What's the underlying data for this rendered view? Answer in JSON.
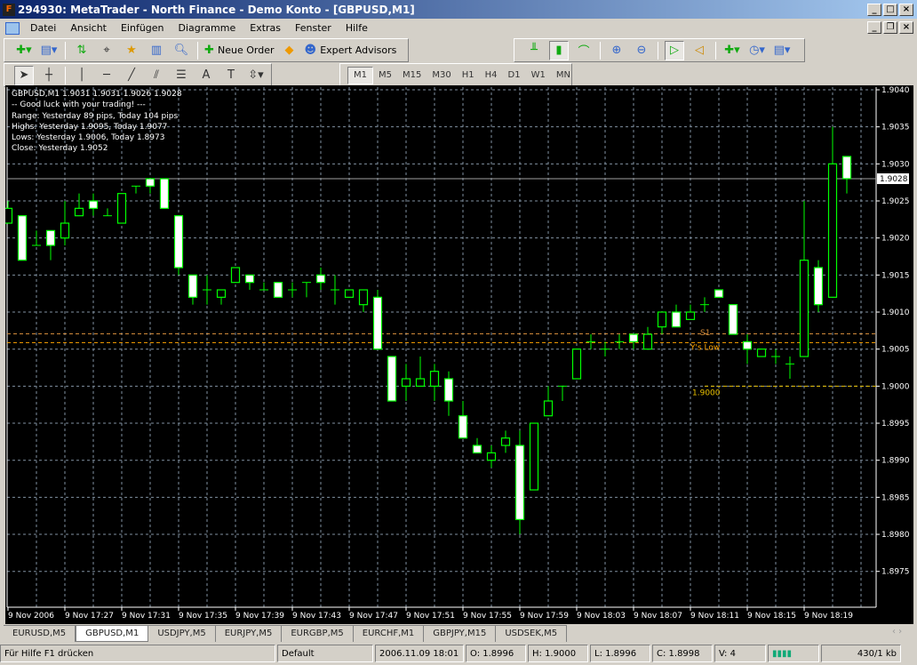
{
  "window": {
    "title": "294930: MetaTrader - North Finance - Demo Konto - [GBPUSD,M1]"
  },
  "menu": [
    "Datei",
    "Ansicht",
    "Einfügen",
    "Diagramme",
    "Extras",
    "Fenster",
    "Hilfe"
  ],
  "toolbar": {
    "new_order": "Neue Order",
    "expert_advisors": "Expert Advisors"
  },
  "timeframes": [
    "M1",
    "M5",
    "M15",
    "M30",
    "H1",
    "H4",
    "D1",
    "W1",
    "MN"
  ],
  "selected_timeframe": "M1",
  "info": {
    "line1": "GBPUSD,M1  1.9031 1.9031 1.9026 1.9028",
    "line2": "-- Good luck with your trading! ---",
    "line3": "Range: Yesterday 89 pips, Today 104 pips",
    "line4": "Highs: Yesterday 1.9095, Today 1.9077",
    "line5": "Lows:  Yesterday 1.9006, Today 1.8973",
    "line6": "Close: Yesterday 1.9052"
  },
  "chart_data": {
    "type": "candlestick",
    "symbol": "GBPUSD",
    "timeframe": "M1",
    "ylim": [
      1.897,
      1.904
    ],
    "yticks": [
      "1.9040",
      "1.9035",
      "1.9030",
      "1.9025",
      "1.9020",
      "1.9015",
      "1.9010",
      "1.9005",
      "1.9000",
      "1.8995",
      "1.8990",
      "1.8985",
      "1.8980",
      "1.8975"
    ],
    "xticks": [
      "9 Nov 2006",
      "9 Nov 17:27",
      "9 Nov 17:31",
      "9 Nov 17:35",
      "9 Nov 17:39",
      "9 Nov 17:43",
      "9 Nov 17:47",
      "9 Nov 17:51",
      "9 Nov 17:55",
      "9 Nov 17:59",
      "9 Nov 18:03",
      "9 Nov 18:07",
      "9 Nov 18:11",
      "9 Nov 18:15",
      "9 Nov 18:19"
    ],
    "current_price": "1.9028",
    "levels": [
      {
        "label": "S1",
        "price": 1.9007,
        "color": "#d08a3a"
      },
      {
        "label": "Y's Low",
        "price": 1.9006,
        "color": "#ffa500"
      },
      {
        "label": "1.9000",
        "price": 1.9,
        "color": "#e8c000"
      }
    ],
    "colors": {
      "bull": "#000000",
      "bear": "#ffffff",
      "outline": "#00ff00",
      "grid": "#8090a0"
    },
    "ohlc": [
      [
        1.9022,
        1.9025,
        1.9022,
        1.9024
      ],
      [
        1.9023,
        1.9023,
        1.9017,
        1.9017
      ],
      [
        1.9019,
        1.9021,
        1.9019,
        1.9019
      ],
      [
        1.9021,
        1.9021,
        1.9017,
        1.9019
      ],
      [
        1.902,
        1.9025,
        1.9019,
        1.9022
      ],
      [
        1.9023,
        1.9026,
        1.9023,
        1.9024
      ],
      [
        1.9025,
        1.9026,
        1.9023,
        1.9024
      ],
      [
        1.9023,
        1.9024,
        1.9023,
        1.9023
      ],
      [
        1.9022,
        1.9026,
        1.9022,
        1.9026
      ],
      [
        1.9027,
        1.9027,
        1.9026,
        1.9027
      ],
      [
        1.9028,
        1.9028,
        1.9026,
        1.9027
      ],
      [
        1.9028,
        1.9028,
        1.9024,
        1.9024
      ],
      [
        1.9023,
        1.9023,
        1.9015,
        1.9016
      ],
      [
        1.9015,
        1.9015,
        1.9011,
        1.9012
      ],
      [
        1.9013,
        1.9015,
        1.9011,
        1.9013
      ],
      [
        1.9012,
        1.9013,
        1.9011,
        1.9013
      ],
      [
        1.9014,
        1.9016,
        1.9014,
        1.9016
      ],
      [
        1.9015,
        1.9015,
        1.9013,
        1.9014
      ],
      [
        1.9013,
        1.9014,
        1.9013,
        1.9013
      ],
      [
        1.9014,
        1.9014,
        1.9012,
        1.9012
      ],
      [
        1.9013,
        1.9014,
        1.9012,
        1.9013
      ],
      [
        1.9014,
        1.9014,
        1.9012,
        1.9014
      ],
      [
        1.9015,
        1.9016,
        1.9013,
        1.9014
      ],
      [
        1.9013,
        1.9015,
        1.9011,
        1.9013
      ],
      [
        1.9012,
        1.9013,
        1.9012,
        1.9013
      ],
      [
        1.9011,
        1.9013,
        1.901,
        1.9013
      ],
      [
        1.9012,
        1.9013,
        1.9005,
        1.9005
      ],
      [
        1.9004,
        1.9004,
        1.8998,
        1.8998
      ],
      [
        1.9,
        1.9003,
        1.8998,
        1.9001
      ],
      [
        1.9,
        1.9004,
        1.9,
        1.9001
      ],
      [
        1.9,
        1.9003,
        1.8998,
        1.9002
      ],
      [
        1.9001,
        1.9002,
        1.8996,
        1.8998
      ],
      [
        1.8996,
        1.8998,
        1.8993,
        1.8993
      ],
      [
        1.8992,
        1.8993,
        1.8991,
        1.8991
      ],
      [
        1.899,
        1.8992,
        1.8989,
        1.8991
      ],
      [
        1.8992,
        1.8994,
        1.8991,
        1.8993
      ],
      [
        1.8992,
        1.8994,
        1.898,
        1.8982
      ],
      [
        1.8986,
        1.8995,
        1.8986,
        1.8995
      ],
      [
        1.8996,
        1.9,
        1.8996,
        1.8998
      ],
      [
        1.9,
        1.9,
        1.8998,
        1.9
      ],
      [
        1.9001,
        1.9005,
        1.9001,
        1.9005
      ],
      [
        1.9006,
        1.9007,
        1.9005,
        1.9006
      ],
      [
        1.9005,
        1.9006,
        1.9004,
        1.9005
      ],
      [
        1.9006,
        1.9007,
        1.9005,
        1.9006
      ],
      [
        1.9007,
        1.9007,
        1.9005,
        1.9006
      ],
      [
        1.9005,
        1.9008,
        1.9005,
        1.9007
      ],
      [
        1.9008,
        1.901,
        1.9007,
        1.901
      ],
      [
        1.901,
        1.9011,
        1.9008,
        1.9008
      ],
      [
        1.9009,
        1.9011,
        1.9009,
        1.901
      ],
      [
        1.9011,
        1.9012,
        1.901,
        1.9011
      ],
      [
        1.9013,
        1.9013,
        1.9012,
        1.9012
      ],
      [
        1.9011,
        1.9011,
        1.9007,
        1.9007
      ],
      [
        1.9006,
        1.9007,
        1.9003,
        1.9005
      ],
      [
        1.9004,
        1.9005,
        1.9004,
        1.9005
      ],
      [
        1.9004,
        1.9005,
        1.9003,
        1.9004
      ],
      [
        1.9003,
        1.9004,
        1.9001,
        1.9003
      ],
      [
        1.9004,
        1.9025,
        1.9004,
        1.9017
      ],
      [
        1.9016,
        1.9017,
        1.901,
        1.9011
      ],
      [
        1.9012,
        1.9035,
        1.9012,
        1.903
      ],
      [
        1.9031,
        1.9031,
        1.9026,
        1.9028
      ]
    ]
  },
  "tabs": [
    "EURUSD,M5",
    "GBPUSD,M1",
    "USDJPY,M5",
    "EURJPY,M5",
    "EURGBP,M5",
    "EURCHF,M1",
    "GBPJPY,M15",
    "USDSEK,M5"
  ],
  "active_tab": "GBPUSD,M1",
  "status": {
    "help": "Für Hilfe F1 drücken",
    "profile": "Default",
    "time": "2006.11.09 18:01",
    "open": "O: 1.8996",
    "high": "H: 1.9000",
    "low": "L: 1.8996",
    "close": "C: 1.8998",
    "volume": "V: 4",
    "traffic": "430/1 kb"
  }
}
